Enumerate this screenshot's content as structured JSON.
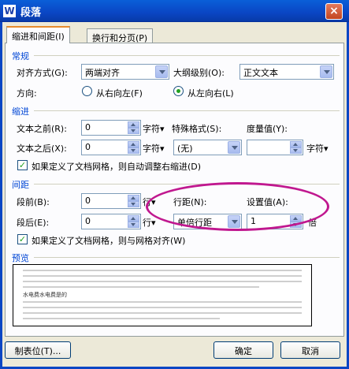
{
  "window": {
    "title": "段落",
    "app_icon_glyph": "W"
  },
  "tabs": [
    {
      "label": "缩进和间距(I)",
      "active": true
    },
    {
      "label": "换行和分页(P)",
      "active": false
    }
  ],
  "general": {
    "section_label": "常规",
    "alignment_label": "对齐方式(G):",
    "alignment_value": "两端对齐",
    "outline_label": "大纲级别(O):",
    "outline_value": "正文文本",
    "direction_label": "方向:",
    "rtl_label": "从右向左(F)",
    "ltr_label": "从左向右(L)",
    "selected_direction": "ltr"
  },
  "indent": {
    "section_label": "缩进",
    "before_label": "文本之前(R):",
    "before_value": "0",
    "before_unit": "字符",
    "after_label": "文本之后(X):",
    "after_value": "0",
    "after_unit": "字符",
    "special_label": "特殊格式(S):",
    "special_value": "(无)",
    "measure_label": "度量值(Y):",
    "measure_value": "",
    "measure_unit": "字符",
    "auto_adjust_label": "如果定义了文档网格，则自动调整右缩进(D)",
    "auto_adjust_checked": true
  },
  "spacing": {
    "section_label": "间距",
    "before_label": "段前(B):",
    "before_value": "0",
    "before_unit": "行",
    "after_label": "段后(E):",
    "after_value": "0",
    "after_unit": "行",
    "line_spacing_label": "行距(N):",
    "line_spacing_value": "单倍行距",
    "set_value_label": "设置值(A):",
    "set_value": "1",
    "set_value_unit": "倍",
    "snap_grid_label": "如果定义了文档网格，则与网格对齐(W)",
    "snap_grid_checked": true
  },
  "preview": {
    "section_label": "预览",
    "sample_text": "水电费水电费是的"
  },
  "buttons": {
    "tabs_label": "制表位(T)...",
    "ok_label": "确定",
    "cancel_label": "取消"
  },
  "colors": {
    "titlebar": "#0a46c4",
    "section_label": "#0046d5",
    "annotation_ellipse": "#c0188f"
  },
  "icons": [
    "close-icon",
    "dropdown-arrow-icon",
    "spin-up-icon",
    "spin-down-icon"
  ]
}
